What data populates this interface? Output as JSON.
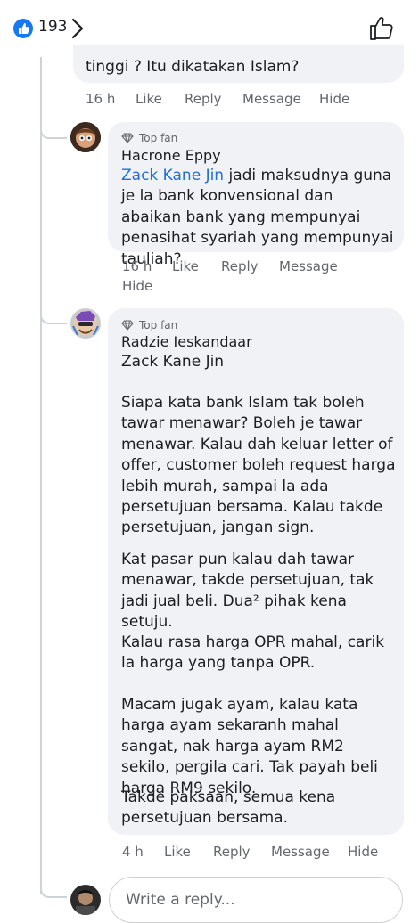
{
  "header": {
    "like_count": "193"
  },
  "comment0": {
    "text_tail": "tinggi ? Itu dikatakan Islam?",
    "time": "16 h",
    "like": "Like",
    "reply": "Reply",
    "message": "Message",
    "hide": "Hide"
  },
  "comment1": {
    "badge": "Top fan",
    "author": "Hacrone Eppy",
    "mention": "Zack Kane Jin",
    "text": " jadi maksudnya guna je la bank konvensional dan abaikan bank yang mempunyai penasihat syariah yang mempunyai tauliah?",
    "time": "16 h",
    "like": "Like",
    "reply": "Reply",
    "message": "Message",
    "hide": "Hide"
  },
  "comment2": {
    "badge": "Top fan",
    "author": "Radzie Ieskandaar",
    "mention": "Zack Kane Jin",
    "paragraphs": [
      "Siapa kata bank Islam tak boleh tawar menawar? Boleh je tawar menawar. Kalau dah keluar letter of offer, customer boleh request harga lebih murah, sampai la ada persetujuan bersama. Kalau takde persetujuan, jangan sign.",
      "Kat pasar pun kalau dah tawar menawar, takde persetujuan, tak jadi jual beli. Dua² pihak kena setuju.",
      "Kalau rasa harga OPR mahal, carik la harga yang tanpa OPR.",
      "Macam jugak ayam, kalau kata harga ayam sekaranh mahal sangat, nak harga ayam RM2 sekilo, pergila cari. Tak payah beli harga RM9 sekilo.",
      "Takde paksaan, semua kena persetujuan bersama."
    ],
    "time": "4 h",
    "like": "Like",
    "reply": "Reply",
    "message": "Message",
    "hide": "Hide"
  },
  "reply_box": {
    "placeholder": "Write a reply..."
  }
}
